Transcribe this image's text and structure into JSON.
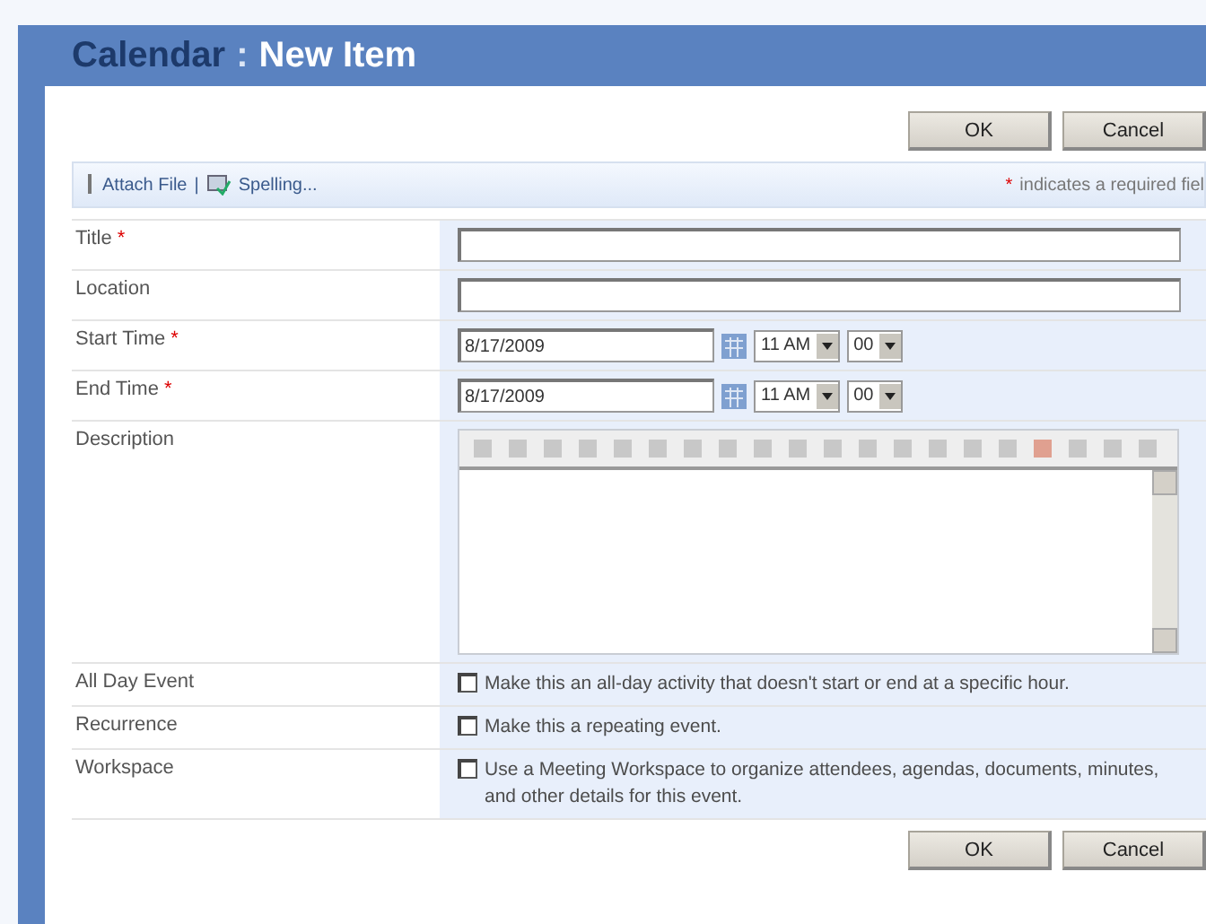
{
  "header": {
    "list_name": "Calendar",
    "separator": ":",
    "page_title": "New Item"
  },
  "top_buttons": [
    "OK",
    "Cancel"
  ],
  "toolbar": {
    "items": [
      {
        "label": "Attach File",
        "kind": "attach"
      },
      {
        "label": "Spelling...",
        "kind": "spelling"
      }
    ],
    "separator": "|",
    "required_mark": "*",
    "required_note": "indicates a required fiel"
  },
  "fields": [
    {
      "label": "Title",
      "required_mark": "*",
      "kind": "text"
    },
    {
      "label": "Location",
      "kind": "text"
    },
    {
      "label": "Start Time",
      "required_mark": "*",
      "kind": "datetime",
      "date": "8/17/2009",
      "hour": "11 AM",
      "minute": "00"
    },
    {
      "label": "End Time",
      "required_mark": "*",
      "kind": "datetime",
      "date": "8/17/2009",
      "hour": "11 AM",
      "minute": "00"
    },
    {
      "label": "Description",
      "kind": "richtext"
    },
    {
      "label": "All Day Event",
      "kind": "checkbox",
      "checked": false,
      "text": "Make this an all-day activity that doesn't start or end at a specific hour."
    },
    {
      "label": "Recurrence",
      "kind": "checkbox",
      "checked": false,
      "text": "Make this a repeating event."
    },
    {
      "label": "Workspace",
      "kind": "checkbox",
      "checked": false,
      "text": "Use a Meeting Workspace to organize attendees, agendas, documents, minutes, and other details for this event."
    }
  ],
  "bottom_buttons": [
    "OK",
    "Cancel"
  ]
}
